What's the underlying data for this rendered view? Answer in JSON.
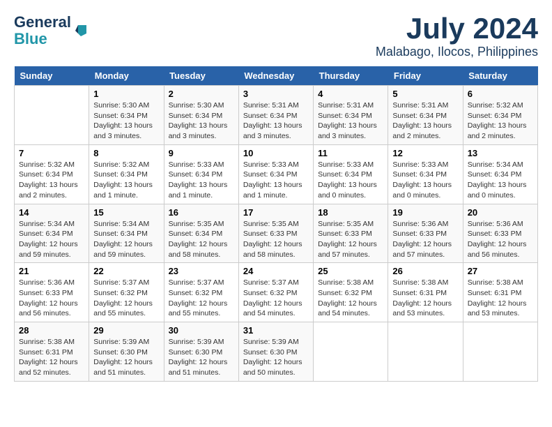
{
  "header": {
    "logo_line1": "General",
    "logo_line2": "Blue",
    "month": "July 2024",
    "location": "Malabago, Ilocos, Philippines"
  },
  "columns": [
    "Sunday",
    "Monday",
    "Tuesday",
    "Wednesday",
    "Thursday",
    "Friday",
    "Saturday"
  ],
  "weeks": [
    [
      {
        "day": "",
        "info": ""
      },
      {
        "day": "1",
        "info": "Sunrise: 5:30 AM\nSunset: 6:34 PM\nDaylight: 13 hours\nand 3 minutes."
      },
      {
        "day": "2",
        "info": "Sunrise: 5:30 AM\nSunset: 6:34 PM\nDaylight: 13 hours\nand 3 minutes."
      },
      {
        "day": "3",
        "info": "Sunrise: 5:31 AM\nSunset: 6:34 PM\nDaylight: 13 hours\nand 3 minutes."
      },
      {
        "day": "4",
        "info": "Sunrise: 5:31 AM\nSunset: 6:34 PM\nDaylight: 13 hours\nand 3 minutes."
      },
      {
        "day": "5",
        "info": "Sunrise: 5:31 AM\nSunset: 6:34 PM\nDaylight: 13 hours\nand 2 minutes."
      },
      {
        "day": "6",
        "info": "Sunrise: 5:32 AM\nSunset: 6:34 PM\nDaylight: 13 hours\nand 2 minutes."
      }
    ],
    [
      {
        "day": "7",
        "info": "Sunrise: 5:32 AM\nSunset: 6:34 PM\nDaylight: 13 hours\nand 2 minutes."
      },
      {
        "day": "8",
        "info": "Sunrise: 5:32 AM\nSunset: 6:34 PM\nDaylight: 13 hours\nand 1 minute."
      },
      {
        "day": "9",
        "info": "Sunrise: 5:33 AM\nSunset: 6:34 PM\nDaylight: 13 hours\nand 1 minute."
      },
      {
        "day": "10",
        "info": "Sunrise: 5:33 AM\nSunset: 6:34 PM\nDaylight: 13 hours\nand 1 minute."
      },
      {
        "day": "11",
        "info": "Sunrise: 5:33 AM\nSunset: 6:34 PM\nDaylight: 13 hours\nand 0 minutes."
      },
      {
        "day": "12",
        "info": "Sunrise: 5:33 AM\nSunset: 6:34 PM\nDaylight: 13 hours\nand 0 minutes."
      },
      {
        "day": "13",
        "info": "Sunrise: 5:34 AM\nSunset: 6:34 PM\nDaylight: 13 hours\nand 0 minutes."
      }
    ],
    [
      {
        "day": "14",
        "info": "Sunrise: 5:34 AM\nSunset: 6:34 PM\nDaylight: 12 hours\nand 59 minutes."
      },
      {
        "day": "15",
        "info": "Sunrise: 5:34 AM\nSunset: 6:34 PM\nDaylight: 12 hours\nand 59 minutes."
      },
      {
        "day": "16",
        "info": "Sunrise: 5:35 AM\nSunset: 6:34 PM\nDaylight: 12 hours\nand 58 minutes."
      },
      {
        "day": "17",
        "info": "Sunrise: 5:35 AM\nSunset: 6:33 PM\nDaylight: 12 hours\nand 58 minutes."
      },
      {
        "day": "18",
        "info": "Sunrise: 5:35 AM\nSunset: 6:33 PM\nDaylight: 12 hours\nand 57 minutes."
      },
      {
        "day": "19",
        "info": "Sunrise: 5:36 AM\nSunset: 6:33 PM\nDaylight: 12 hours\nand 57 minutes."
      },
      {
        "day": "20",
        "info": "Sunrise: 5:36 AM\nSunset: 6:33 PM\nDaylight: 12 hours\nand 56 minutes."
      }
    ],
    [
      {
        "day": "21",
        "info": "Sunrise: 5:36 AM\nSunset: 6:33 PM\nDaylight: 12 hours\nand 56 minutes."
      },
      {
        "day": "22",
        "info": "Sunrise: 5:37 AM\nSunset: 6:32 PM\nDaylight: 12 hours\nand 55 minutes."
      },
      {
        "day": "23",
        "info": "Sunrise: 5:37 AM\nSunset: 6:32 PM\nDaylight: 12 hours\nand 55 minutes."
      },
      {
        "day": "24",
        "info": "Sunrise: 5:37 AM\nSunset: 6:32 PM\nDaylight: 12 hours\nand 54 minutes."
      },
      {
        "day": "25",
        "info": "Sunrise: 5:38 AM\nSunset: 6:32 PM\nDaylight: 12 hours\nand 54 minutes."
      },
      {
        "day": "26",
        "info": "Sunrise: 5:38 AM\nSunset: 6:31 PM\nDaylight: 12 hours\nand 53 minutes."
      },
      {
        "day": "27",
        "info": "Sunrise: 5:38 AM\nSunset: 6:31 PM\nDaylight: 12 hours\nand 53 minutes."
      }
    ],
    [
      {
        "day": "28",
        "info": "Sunrise: 5:38 AM\nSunset: 6:31 PM\nDaylight: 12 hours\nand 52 minutes."
      },
      {
        "day": "29",
        "info": "Sunrise: 5:39 AM\nSunset: 6:30 PM\nDaylight: 12 hours\nand 51 minutes."
      },
      {
        "day": "30",
        "info": "Sunrise: 5:39 AM\nSunset: 6:30 PM\nDaylight: 12 hours\nand 51 minutes."
      },
      {
        "day": "31",
        "info": "Sunrise: 5:39 AM\nSunset: 6:30 PM\nDaylight: 12 hours\nand 50 minutes."
      },
      {
        "day": "",
        "info": ""
      },
      {
        "day": "",
        "info": ""
      },
      {
        "day": "",
        "info": ""
      }
    ]
  ]
}
